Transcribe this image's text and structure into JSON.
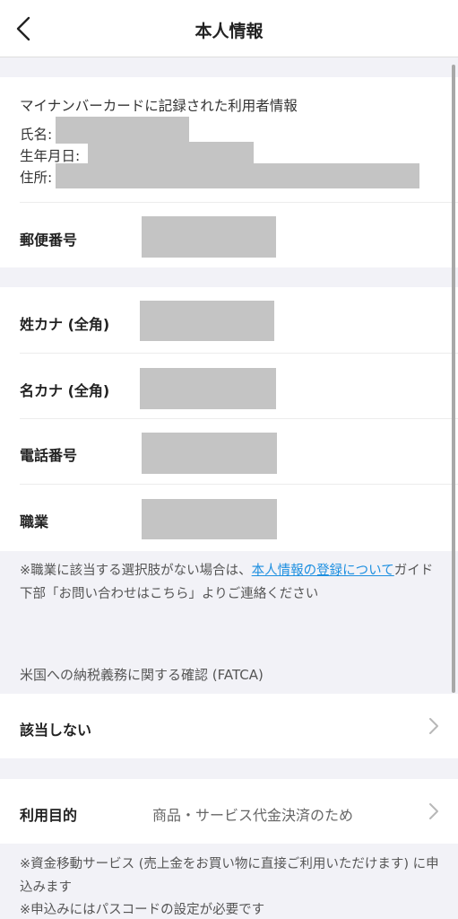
{
  "nav": {
    "title": "本人情報"
  },
  "mynumber_card": {
    "title": "マイナンバーカードに記録された利用者情報",
    "name_label": "氏名:",
    "birthdate_label": "生年月日:",
    "address_label": "住所:"
  },
  "postal": {
    "label": "郵便番号"
  },
  "profile": {
    "kana_last_label": "姓カナ (全角)",
    "kana_first_label": "名カナ (全角)",
    "phone_label": "電話番号",
    "occupation_label": "職業"
  },
  "occupation_note": {
    "prefix": "※職業に該当する選択肢がない場合は、",
    "link": "本人情報の登録について",
    "suffix": "ガイド下部「お問い合わせはこちら」よりご連絡ください"
  },
  "fatca": {
    "header": "米国への納税義務に関する確認 (FATCA)",
    "value": "該当しない"
  },
  "purpose": {
    "label": "利用目的",
    "value": "商品・サービス代金決済のため"
  },
  "footer_notes": {
    "note1": "※資金移動サービス (売上金をお買い物に直接ご利用いただけます) に申込みます",
    "note2": "※申込みにはパスコードの設定が必要です"
  },
  "icons": {
    "back": "chevron-left-icon",
    "row_arrow": "chevron-right-icon"
  }
}
